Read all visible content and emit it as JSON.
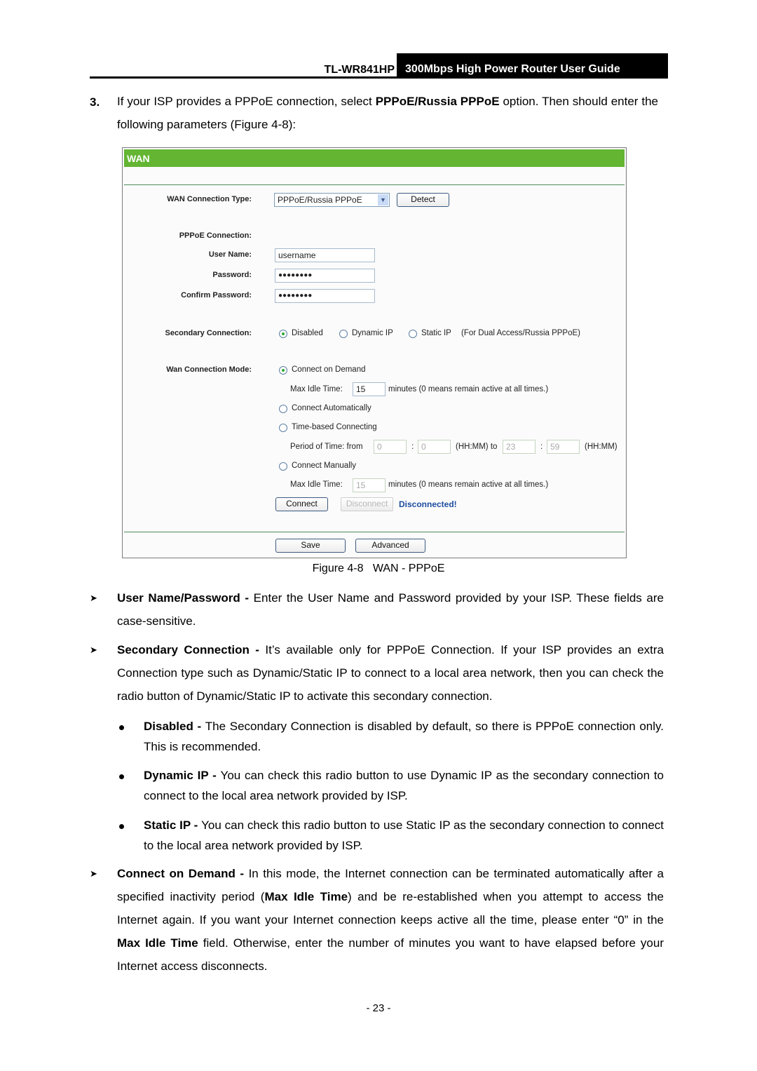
{
  "header": {
    "model": "TL-WR841HP",
    "title": "300Mbps High Power Router User Guide"
  },
  "intro": {
    "number": "3.",
    "text_before": "If your ISP provides a PPPoE connection, select ",
    "bold": "PPPoE/Russia PPPoE",
    "text_after": " option. Then should enter the following parameters (Figure 4-8):"
  },
  "figure": {
    "panel_title": "WAN",
    "wan_connection_type": {
      "label": "WAN Connection Type:",
      "selected": "PPPoE/Russia PPPoE",
      "detect_label": "Detect"
    },
    "pppoe_connection_label": "PPPoE Connection:",
    "user_name": {
      "label": "User Name:",
      "value": "username"
    },
    "password": {
      "label": "Password:",
      "value": "●●●●●●●●"
    },
    "confirm_password": {
      "label": "Confirm Password:",
      "value": "●●●●●●●●"
    },
    "secondary_connection": {
      "label": "Secondary Connection:",
      "options": [
        "Disabled",
        "Dynamic IP",
        "Static IP"
      ],
      "selected": "Disabled",
      "note": "(For Dual Access/Russia PPPoE)"
    },
    "wan_connection_mode": {
      "label": "Wan Connection Mode:",
      "connect_on_demand": "Connect on Demand",
      "max_idle_label": "Max Idle Time:",
      "max_idle_value": "15",
      "max_idle_note": "minutes (0 means remain active at all times.)",
      "connect_automatically": "Connect Automatically",
      "time_based": "Time-based Connecting",
      "period_label": "Period of Time: from",
      "from_hh": "0",
      "from_mm": "0",
      "colon": ":",
      "hhmm_to": "(HH:MM) to",
      "to_hh": "23",
      "to_mm": "59",
      "hhmm": "(HH:MM)",
      "connect_manually": "Connect Manually",
      "manual_max_idle_label": "Max Idle Time:",
      "manual_max_idle_value": "15",
      "manual_max_idle_note": "minutes (0 means remain active at all times.)",
      "selected": "Connect on Demand"
    },
    "connect_label": "Connect",
    "disconnect_label": "Disconnect",
    "status": "Disconnected!",
    "save_label": "Save",
    "advanced_label": "Advanced",
    "caption": "Figure 4-8   WAN - PPPoE"
  },
  "bullets": [
    {
      "bold": "User Name/Password - ",
      "text": "Enter the User Name and Password provided by your ISP. These fields are case-sensitive."
    },
    {
      "bold": "Secondary Connection - ",
      "text": "It’s available only for PPPoE Connection. If your ISP provides an extra Connection type such as Dynamic/Static IP to connect to a local area network, then you can check the radio button of Dynamic/Static IP to activate this secondary connection."
    }
  ],
  "sub_bullets": [
    {
      "bold": "Disabled - ",
      "text": "The Secondary Connection is disabled by default, so there is PPPoE connection only. This is recommended."
    },
    {
      "bold": "Dynamic IP - ",
      "text": "You can check this radio button to use Dynamic IP as the secondary connection to connect to the local area network provided by ISP."
    },
    {
      "bold": "Static IP - ",
      "text": "You can check this radio button to use Static IP as the secondary connection to connect to the local area network provided by ISP."
    }
  ],
  "connect_on_demand": {
    "bold": "Connect on Demand - ",
    "t1": "In this mode, the Internet connection can be terminated automatically after a specified inactivity period (",
    "b2": "Max Idle Time",
    "t2": ") and be re-established when you attempt to access the Internet again. If you want your Internet connection keeps active all the time, please enter “0” in the ",
    "b3": "Max Idle Time",
    "t3": " field. Otherwise, enter the number of minutes you want to have elapsed before your Internet access disconnects."
  },
  "page_number": "- 23 -"
}
